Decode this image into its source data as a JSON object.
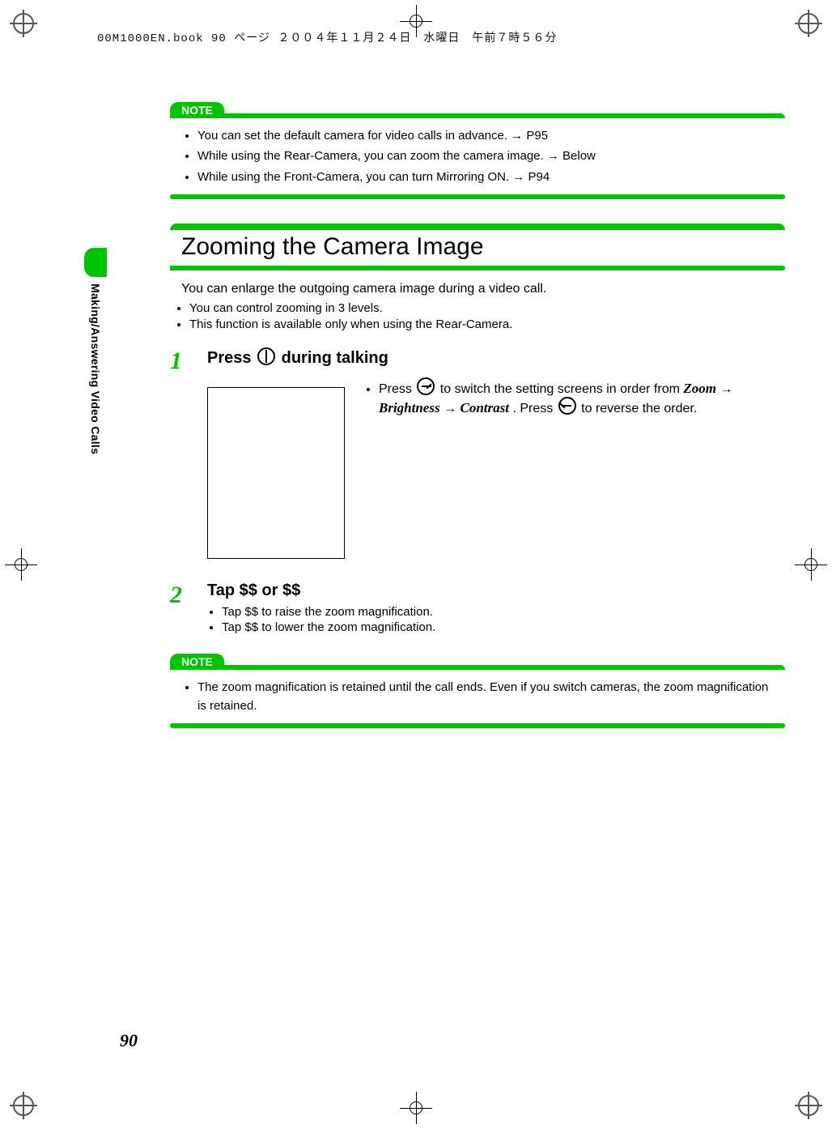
{
  "header": "00M1000EN.book  90 ページ  ２００４年１１月２４日　水曜日　午前７時５６分",
  "side_label": "Making/Answering Video Calls",
  "page_number": "90",
  "note1": {
    "label": "NOTE",
    "items": [
      "You can set the default camera for video calls in advance. → P95",
      "While using the Rear-Camera, you can zoom the camera image. → Below",
      "While using the Front-Camera, you can turn Mirroring ON. → P94"
    ]
  },
  "section": {
    "title": "Zooming the Camera Image",
    "intro": "You can enlarge the outgoing camera image during a video call.",
    "bullets": [
      "You can control zooming in 3 levels.",
      "This function is available only when using the Rear-Camera."
    ]
  },
  "step1": {
    "num": "1",
    "title_pre": "Press ",
    "title_post": " during talking",
    "desc_pre": "Press ",
    "desc_mid1": " to switch the setting screens in order from ",
    "zoom": "Zoom",
    "arrow": " → ",
    "brightness": "Brightness",
    "contrast": "Contrast",
    "desc_mid2": ". Press ",
    "desc_post": " to reverse the order."
  },
  "step2": {
    "num": "2",
    "title": "Tap $$ or $$",
    "items": [
      "Tap $$ to raise the zoom magnification.",
      "Tap $$ to lower the zoom magnification."
    ]
  },
  "note2": {
    "label": "NOTE",
    "item": "The zoom magnification is retained until the call ends. Even if you switch cameras, the zoom magnification is retained."
  }
}
